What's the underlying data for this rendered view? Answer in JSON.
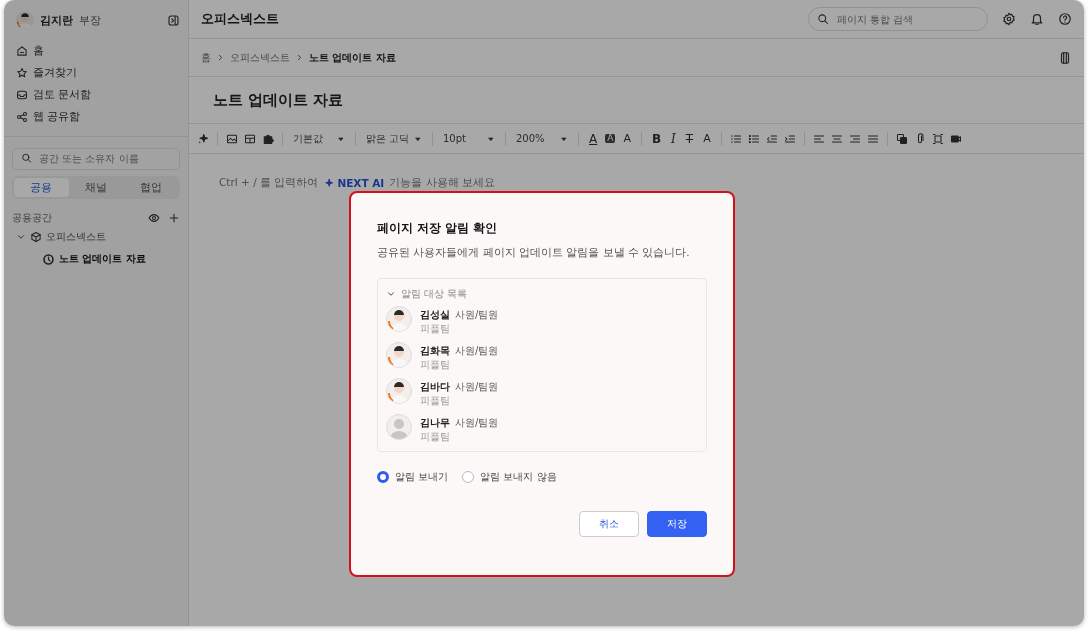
{
  "sidebar": {
    "user": {
      "name": "김지란",
      "title": "부장"
    },
    "nav": [
      {
        "label": "홈"
      },
      {
        "label": "즐겨찾기"
      },
      {
        "label": "검토 문서함"
      },
      {
        "label": "웹 공유함"
      }
    ],
    "search": {
      "placeholder": "공간 또는 소유자 이름"
    },
    "tabs": [
      {
        "label": "공용",
        "selected": true
      },
      {
        "label": "채널",
        "selected": false
      },
      {
        "label": "협업",
        "selected": false
      }
    ],
    "section": {
      "label": "공용공간"
    },
    "tree": [
      {
        "label": "오피스넥스트",
        "expanded": true,
        "children": [
          {
            "label": "노트 업데이트 자료",
            "selected": true
          }
        ]
      }
    ]
  },
  "header": {
    "title": "오피스넥스트",
    "search": {
      "placeholder": "페이지 통합 검색"
    }
  },
  "breadcrumbs": [
    "홈",
    "오피스넥스트",
    "노트 업데이트 자료"
  ],
  "page": {
    "title": "노트 업데이트 자료"
  },
  "toolbar": {
    "dropdowns": [
      "기본값",
      "맑은 고딕",
      "10pt",
      "200%"
    ],
    "text_buttons": [
      {
        "label": "A",
        "kind": "text-color"
      },
      {
        "label": "A",
        "kind": "highlight"
      },
      {
        "label": "A",
        "kind": "style"
      },
      {
        "label": "B",
        "kind": "bold"
      },
      {
        "label": "I",
        "kind": "italic"
      },
      {
        "label": "T",
        "kind": "strike"
      },
      {
        "label": "A",
        "kind": "clear"
      }
    ]
  },
  "editor": {
    "hint": "Ctrl + / 를 입력하여",
    "ai_label": "NEXT AI",
    "hint_rest": "기능을 사용해 보세요"
  },
  "dialog": {
    "title": "페이지 저장 알림 확인",
    "description": "공유된 사용자들에게 페이지 업데이트 알림을 보낼 수 있습니다.",
    "recipients": {
      "label": "알림 대상 목록",
      "expanded": true,
      "people": [
        {
          "name": "김성실",
          "role": "사원/팀원",
          "team": "피플팀",
          "kind": "photo"
        },
        {
          "name": "김화목",
          "role": "사원/팀원",
          "team": "피플팀",
          "kind": "photo"
        },
        {
          "name": "김바다",
          "role": "사원/팀원",
          "team": "피플팀",
          "kind": "photo"
        },
        {
          "name": "김나무",
          "role": "사원/팀원",
          "team": "피플팀",
          "kind": "default"
        }
      ]
    },
    "options": [
      {
        "label": "알림 보내기",
        "selected": true
      },
      {
        "label": "알림 보내지 않음",
        "selected": false
      }
    ],
    "buttons": [
      {
        "label": "취소",
        "kind": "secondary"
      },
      {
        "label": "저장",
        "kind": "primary"
      }
    ]
  }
}
